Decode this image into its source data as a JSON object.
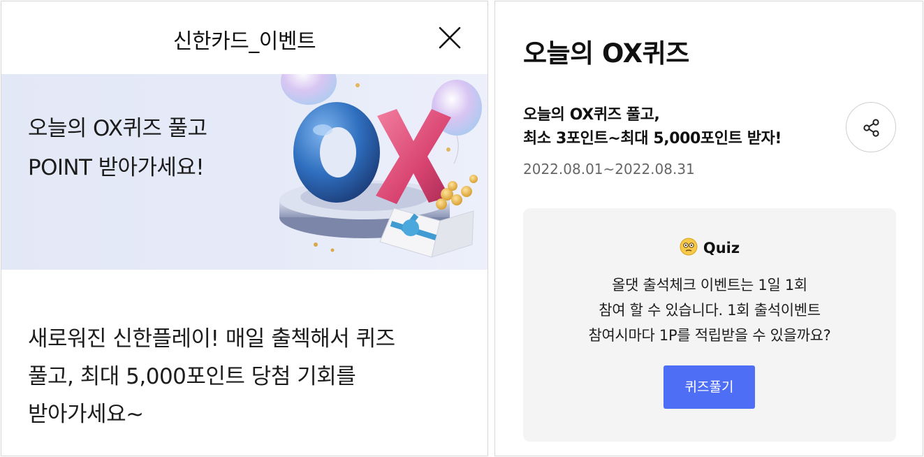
{
  "left_panel": {
    "header_title": "신한카드_이벤트",
    "banner": {
      "line1": "오늘의 OX퀴즈 풀고",
      "line2": "POINT 받아가세요!",
      "art_letters": [
        "O",
        "X"
      ]
    },
    "description": {
      "line1": "새로워진 신한플레이! 매일 출첵해서 퀴즈",
      "line2": "풀고, 최대 5,000포인트 당첨 기회를",
      "line3": "받아가세요~"
    }
  },
  "right_panel": {
    "title": "오늘의 OX퀴즈",
    "headline": {
      "line1": "오늘의 OX퀴즈 풀고,",
      "line2": "최소 3포인트~최대 5,000포인트 받자!"
    },
    "period": "2022.08.01~2022.08.31",
    "quiz": {
      "label": "Quiz",
      "question": {
        "line1": "올댓 출석체크 이벤트는 1일 1회",
        "line2": "참여 할 수 있습니다. 1회 출석이벤트",
        "line3": "참여시마다 1P를 적립받을 수 있을까요?"
      },
      "button_label": "퀴즈풀기"
    }
  },
  "colors": {
    "accent_button": "#4f6ef6",
    "banner_bg": "#e4e9f8",
    "card_bg": "#f4f4f5"
  },
  "icons": [
    "close-icon",
    "share-icon",
    "thinking-face-icon"
  ]
}
